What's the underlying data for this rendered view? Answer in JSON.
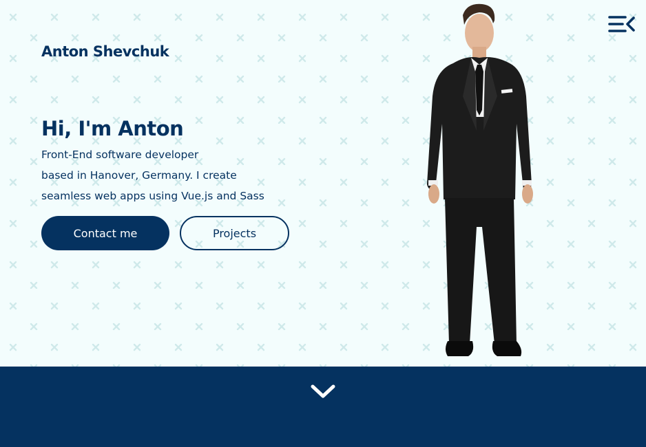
{
  "header": {
    "brand": "Anton Shevchuk",
    "menu_icon": "menu-collapse-icon"
  },
  "hero": {
    "headline": "Hi, I'm Anton",
    "intro_lines": [
      "Front-End software developer",
      "based in Hanover, Germany. I create",
      "seamless web apps using Vue.js and Sass"
    ],
    "contact_label": "Contact me",
    "projects_label": "Projects",
    "portrait_subject": "man-in-black-suit"
  },
  "footer_band": {
    "scroll_icon": "chevron-down-icon"
  },
  "colors": {
    "primary": "#053260",
    "background": "#f3fdfd",
    "pattern": "#d3ecec"
  }
}
